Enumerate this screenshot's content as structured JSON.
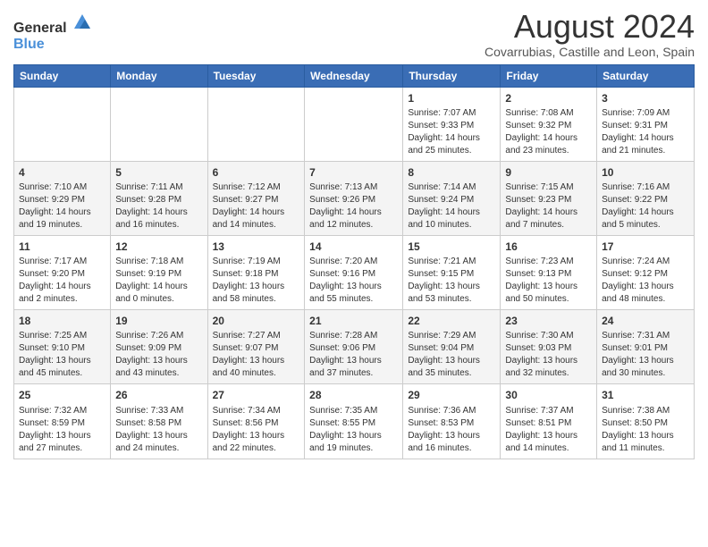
{
  "header": {
    "logo_general": "General",
    "logo_blue": "Blue",
    "month_title": "August 2024",
    "subtitle": "Covarrubias, Castille and Leon, Spain"
  },
  "weekdays": [
    "Sunday",
    "Monday",
    "Tuesday",
    "Wednesday",
    "Thursday",
    "Friday",
    "Saturday"
  ],
  "weeks": [
    [
      {
        "day": "",
        "content": ""
      },
      {
        "day": "",
        "content": ""
      },
      {
        "day": "",
        "content": ""
      },
      {
        "day": "",
        "content": ""
      },
      {
        "day": "1",
        "content": "Sunrise: 7:07 AM\nSunset: 9:33 PM\nDaylight: 14 hours\nand 25 minutes."
      },
      {
        "day": "2",
        "content": "Sunrise: 7:08 AM\nSunset: 9:32 PM\nDaylight: 14 hours\nand 23 minutes."
      },
      {
        "day": "3",
        "content": "Sunrise: 7:09 AM\nSunset: 9:31 PM\nDaylight: 14 hours\nand 21 minutes."
      }
    ],
    [
      {
        "day": "4",
        "content": "Sunrise: 7:10 AM\nSunset: 9:29 PM\nDaylight: 14 hours\nand 19 minutes."
      },
      {
        "day": "5",
        "content": "Sunrise: 7:11 AM\nSunset: 9:28 PM\nDaylight: 14 hours\nand 16 minutes."
      },
      {
        "day": "6",
        "content": "Sunrise: 7:12 AM\nSunset: 9:27 PM\nDaylight: 14 hours\nand 14 minutes."
      },
      {
        "day": "7",
        "content": "Sunrise: 7:13 AM\nSunset: 9:26 PM\nDaylight: 14 hours\nand 12 minutes."
      },
      {
        "day": "8",
        "content": "Sunrise: 7:14 AM\nSunset: 9:24 PM\nDaylight: 14 hours\nand 10 minutes."
      },
      {
        "day": "9",
        "content": "Sunrise: 7:15 AM\nSunset: 9:23 PM\nDaylight: 14 hours\nand 7 minutes."
      },
      {
        "day": "10",
        "content": "Sunrise: 7:16 AM\nSunset: 9:22 PM\nDaylight: 14 hours\nand 5 minutes."
      }
    ],
    [
      {
        "day": "11",
        "content": "Sunrise: 7:17 AM\nSunset: 9:20 PM\nDaylight: 14 hours\nand 2 minutes."
      },
      {
        "day": "12",
        "content": "Sunrise: 7:18 AM\nSunset: 9:19 PM\nDaylight: 14 hours\nand 0 minutes."
      },
      {
        "day": "13",
        "content": "Sunrise: 7:19 AM\nSunset: 9:18 PM\nDaylight: 13 hours\nand 58 minutes."
      },
      {
        "day": "14",
        "content": "Sunrise: 7:20 AM\nSunset: 9:16 PM\nDaylight: 13 hours\nand 55 minutes."
      },
      {
        "day": "15",
        "content": "Sunrise: 7:21 AM\nSunset: 9:15 PM\nDaylight: 13 hours\nand 53 minutes."
      },
      {
        "day": "16",
        "content": "Sunrise: 7:23 AM\nSunset: 9:13 PM\nDaylight: 13 hours\nand 50 minutes."
      },
      {
        "day": "17",
        "content": "Sunrise: 7:24 AM\nSunset: 9:12 PM\nDaylight: 13 hours\nand 48 minutes."
      }
    ],
    [
      {
        "day": "18",
        "content": "Sunrise: 7:25 AM\nSunset: 9:10 PM\nDaylight: 13 hours\nand 45 minutes."
      },
      {
        "day": "19",
        "content": "Sunrise: 7:26 AM\nSunset: 9:09 PM\nDaylight: 13 hours\nand 43 minutes."
      },
      {
        "day": "20",
        "content": "Sunrise: 7:27 AM\nSunset: 9:07 PM\nDaylight: 13 hours\nand 40 minutes."
      },
      {
        "day": "21",
        "content": "Sunrise: 7:28 AM\nSunset: 9:06 PM\nDaylight: 13 hours\nand 37 minutes."
      },
      {
        "day": "22",
        "content": "Sunrise: 7:29 AM\nSunset: 9:04 PM\nDaylight: 13 hours\nand 35 minutes."
      },
      {
        "day": "23",
        "content": "Sunrise: 7:30 AM\nSunset: 9:03 PM\nDaylight: 13 hours\nand 32 minutes."
      },
      {
        "day": "24",
        "content": "Sunrise: 7:31 AM\nSunset: 9:01 PM\nDaylight: 13 hours\nand 30 minutes."
      }
    ],
    [
      {
        "day": "25",
        "content": "Sunrise: 7:32 AM\nSunset: 8:59 PM\nDaylight: 13 hours\nand 27 minutes."
      },
      {
        "day": "26",
        "content": "Sunrise: 7:33 AM\nSunset: 8:58 PM\nDaylight: 13 hours\nand 24 minutes."
      },
      {
        "day": "27",
        "content": "Sunrise: 7:34 AM\nSunset: 8:56 PM\nDaylight: 13 hours\nand 22 minutes."
      },
      {
        "day": "28",
        "content": "Sunrise: 7:35 AM\nSunset: 8:55 PM\nDaylight: 13 hours\nand 19 minutes."
      },
      {
        "day": "29",
        "content": "Sunrise: 7:36 AM\nSunset: 8:53 PM\nDaylight: 13 hours\nand 16 minutes."
      },
      {
        "day": "30",
        "content": "Sunrise: 7:37 AM\nSunset: 8:51 PM\nDaylight: 13 hours\nand 14 minutes."
      },
      {
        "day": "31",
        "content": "Sunrise: 7:38 AM\nSunset: 8:50 PM\nDaylight: 13 hours\nand 11 minutes."
      }
    ]
  ]
}
